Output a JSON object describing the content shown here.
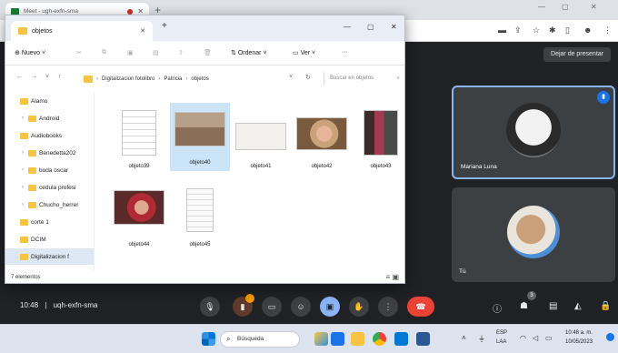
{
  "browser": {
    "tab_title": "Meet - ugh-exfn-sma",
    "stop_presenting_label": "Dejar de presentar"
  },
  "explorer": {
    "tab_title": "objetos",
    "toolbar": {
      "new_label": "Nuevo",
      "sort_label": "Ordenar",
      "view_label": "Ver",
      "more_label": "···"
    },
    "breadcrumb": [
      "Digitalizacion fotolibro",
      "Patricia",
      "objetos"
    ],
    "search_placeholder": "Buscar en objetos",
    "nav_items": [
      "Alamo",
      "Android",
      "Audiobooks",
      "Benedetta202",
      "boda oscar",
      "cedula profesi",
      "Chucho_herrer",
      "corte 1",
      "DCIM",
      "Digitalizacion f"
    ],
    "files": [
      {
        "name": "objeto39",
        "selected": false
      },
      {
        "name": "objeto40",
        "selected": true
      },
      {
        "name": "objeto41",
        "selected": false
      },
      {
        "name": "objeto42",
        "selected": false
      },
      {
        "name": "objeto43",
        "selected": false
      },
      {
        "name": "objeto44",
        "selected": false
      },
      {
        "name": "objeto45",
        "selected": false
      }
    ],
    "status": "7 elementos"
  },
  "meet": {
    "participants": [
      {
        "name": "Mariana Luna"
      },
      {
        "name": "Tú"
      }
    ],
    "time": "10:48",
    "meeting_code": "uqh-exfn-sma",
    "people_count": "3",
    "separator": "|"
  },
  "taskbar": {
    "search_label": "Búsqueda",
    "language": "ESP",
    "keyboard": "LAA",
    "clock_time": "10:48 a. m.",
    "clock_date": "10/05/2023"
  },
  "colors": {
    "meet_bg": "#202124",
    "accent_blue": "#8ab4f8",
    "hangup_red": "#ea4335",
    "folder_yellow": "#f6c342"
  }
}
